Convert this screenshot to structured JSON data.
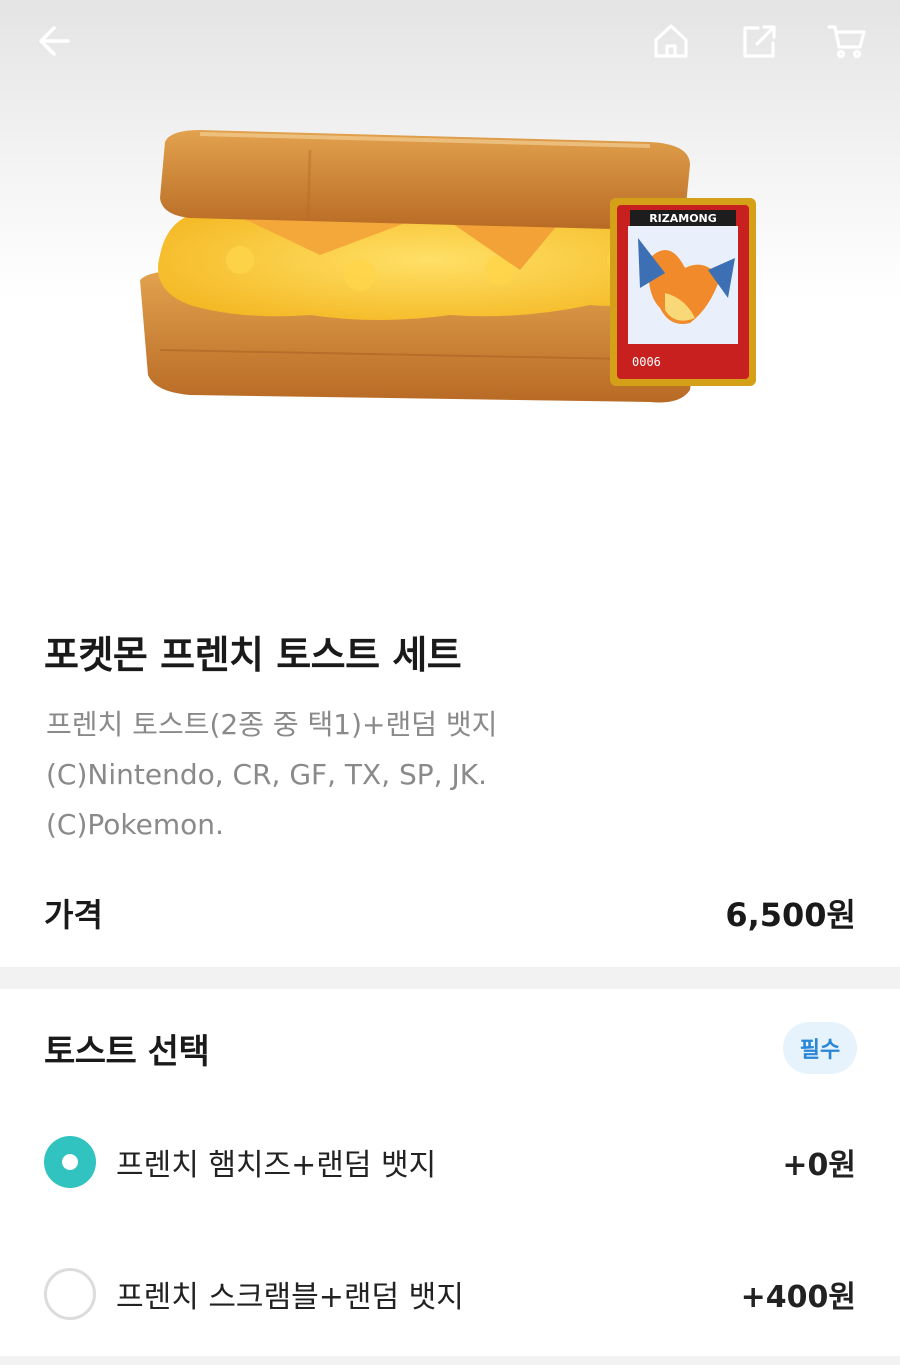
{
  "product": {
    "title": "포켓몬 프렌치 토스트 세트",
    "description": [
      "프렌치 토스트(2종 중 택1)+랜덤 뱃지",
      "(C)Nintendo, CR, GF, TX, SP, JK.",
      "(C)Pokemon."
    ],
    "badge_card": {
      "brand": "RIZAMONG",
      "number": "0006"
    }
  },
  "price": {
    "label": "가격",
    "value": "6,500원"
  },
  "toast_section": {
    "title": "토스트 선택",
    "badge": "필수",
    "options": [
      {
        "label": "프렌치 햄치즈+랜덤 뱃지",
        "price": "+0원",
        "selected": true
      },
      {
        "label": "프렌치 스크램블+랜덤 뱃지",
        "price": "+400원",
        "selected": false
      }
    ]
  },
  "icons": {
    "back": "arrow-left-icon",
    "home": "home-icon",
    "share": "share-icon",
    "cart": "cart-icon"
  },
  "colors": {
    "accent": "#31c3bf",
    "badge_text": "#2a86d6",
    "badge_bg": "#e7f3fc",
    "muted_text": "#8a8a8a"
  }
}
